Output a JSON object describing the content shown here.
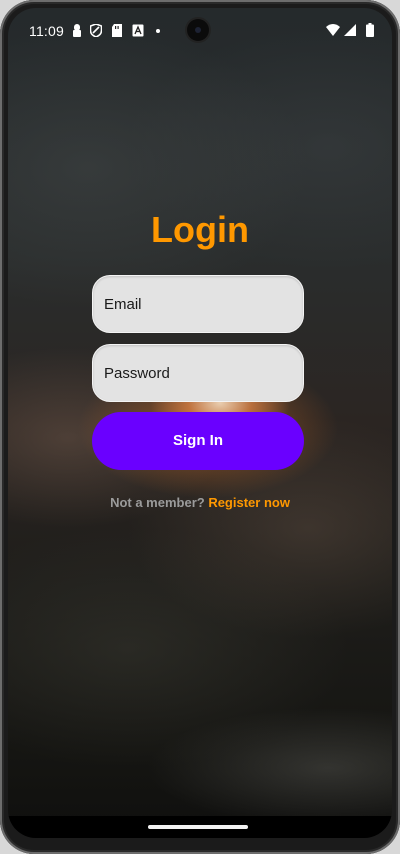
{
  "status_bar": {
    "time": "11:09",
    "icons": [
      "key-icon",
      "shield-icon",
      "sd-card-icon",
      "a-icon",
      "dot-icon",
      "wifi-icon",
      "cellular-icon",
      "battery-icon"
    ]
  },
  "login": {
    "title": "Login",
    "email_placeholder": "Email",
    "password_placeholder": "Password",
    "signin_label": "Sign In",
    "register_prompt": "Not a member?",
    "register_link": "Register now"
  },
  "colors": {
    "accent": "#ff9800",
    "button": "#6a00ff",
    "field_bg": "#e3e3e3"
  }
}
